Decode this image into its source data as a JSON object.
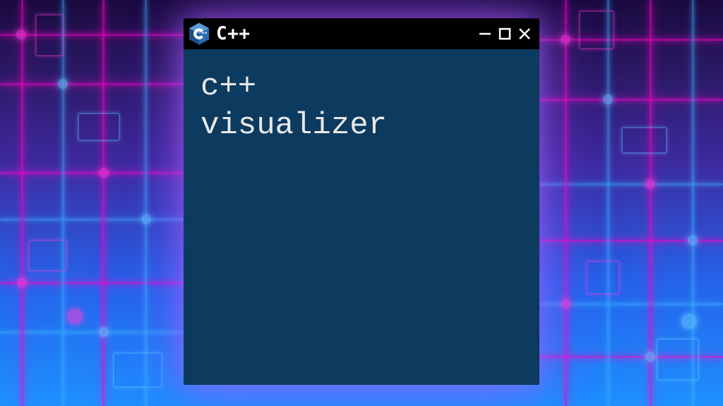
{
  "window": {
    "title": "C++",
    "icon_name": "cpp-hex-icon",
    "body_text": "c++\nvisualizer"
  },
  "controls": {
    "minimize_label": "Minimize",
    "maximize_label": "Maximize",
    "close_label": "Close"
  },
  "colors": {
    "titlebar_bg": "#000000",
    "client_bg": "#0d3a5f",
    "text": "#e8e8e8",
    "icon_primary": "#1c4e8c",
    "icon_light": "#5b9bd5"
  }
}
